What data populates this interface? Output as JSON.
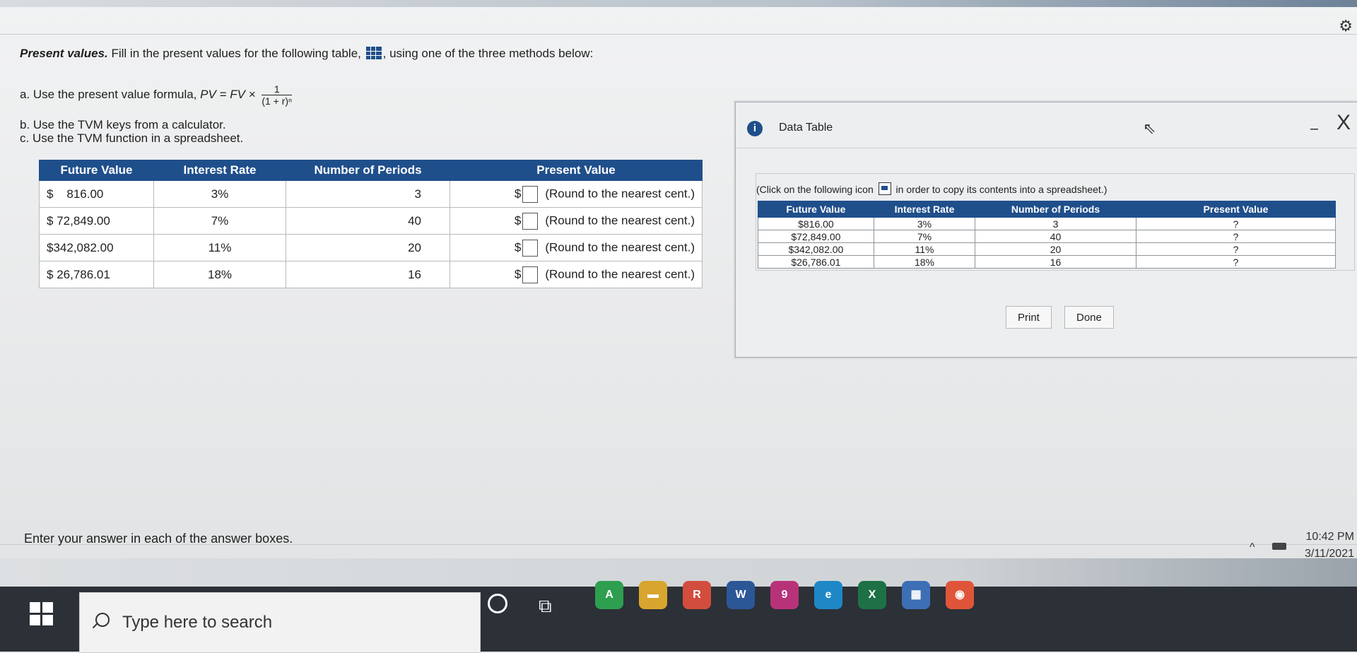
{
  "question": {
    "title_bold": "Present values.",
    "title_text_1": " Fill in the present values for the following table,",
    "title_text_2": ", using one of the three methods below:",
    "method_a_label": "a.  Use the present value formula,",
    "formula_lhs": "PV = FV ×",
    "formula_numerator": "1",
    "formula_denominator": "(1 + r)ⁿ",
    "method_b": "b.  Use the TVM keys from a calculator.",
    "method_c": "c.  Use the TVM function in a spreadsheet."
  },
  "main_table": {
    "headers": [
      "Future Value",
      "Interest Rate",
      "Number of Periods",
      "Present Value"
    ],
    "rows": [
      {
        "fv_sign": "$",
        "fv": "816.00",
        "rate": "3%",
        "periods": "3",
        "pv_prefix": "$",
        "pv_hint": "(Round to the nearest cent.)"
      },
      {
        "fv_sign": "$",
        "fv": "72,849.00",
        "rate": "7%",
        "periods": "40",
        "pv_prefix": "$",
        "pv_hint": "(Round to the nearest cent.)"
      },
      {
        "fv_sign": "",
        "fv": "$342,082.00",
        "rate": "11%",
        "periods": "20",
        "pv_prefix": "$",
        "pv_hint": "(Round to the nearest cent.)"
      },
      {
        "fv_sign": "$",
        "fv": "26,786.01",
        "rate": "18%",
        "periods": "16",
        "pv_prefix": "$",
        "pv_hint": "(Round to the nearest cent.)"
      }
    ]
  },
  "dialog": {
    "title": "Data Table",
    "close_glyph": "X",
    "minimize_glyph": "–",
    "note_before": "(Click on the following icon",
    "note_after": "in order to copy its contents into a spreadsheet.)",
    "headers": [
      "Future Value",
      "Interest Rate",
      "Number of Periods",
      "Present Value"
    ],
    "rows": [
      {
        "fv": "$816.00",
        "rate": "3%",
        "periods": "3",
        "pv": "?"
      },
      {
        "fv": "$72,849.00",
        "rate": "7%",
        "periods": "40",
        "pv": "?"
      },
      {
        "fv": "$342,082.00",
        "rate": "11%",
        "periods": "20",
        "pv": "?"
      },
      {
        "fv": "$26,786.01",
        "rate": "18%",
        "periods": "16",
        "pv": "?"
      }
    ],
    "print_label": "Print",
    "done_label": "Done"
  },
  "footer": {
    "instruction": "Enter your answer in each of the answer boxes."
  },
  "taskbar": {
    "search_placeholder": "Type here to search",
    "time": "10:42 PM",
    "date": "3/11/2021",
    "apps": [
      {
        "name": "chrome-icon",
        "label": "A",
        "color": "#2e9e4f"
      },
      {
        "name": "file-explorer-icon",
        "label": "▬",
        "color": "#d8a52e"
      },
      {
        "name": "chrome-profile-icon",
        "label": "R",
        "color": "#d24d3e"
      },
      {
        "name": "word-icon",
        "label": "W",
        "color": "#2b5797"
      },
      {
        "name": "snipping-icon",
        "label": "9",
        "color": "#b8327a"
      },
      {
        "name": "edge-icon",
        "label": "e",
        "color": "#1e88c7"
      },
      {
        "name": "excel-icon",
        "label": "X",
        "color": "#1e7145"
      },
      {
        "name": "calculator-icon",
        "label": "▦",
        "color": "#3d6fb5"
      },
      {
        "name": "media-player-icon",
        "label": "◉",
        "color": "#e0553a"
      }
    ]
  }
}
